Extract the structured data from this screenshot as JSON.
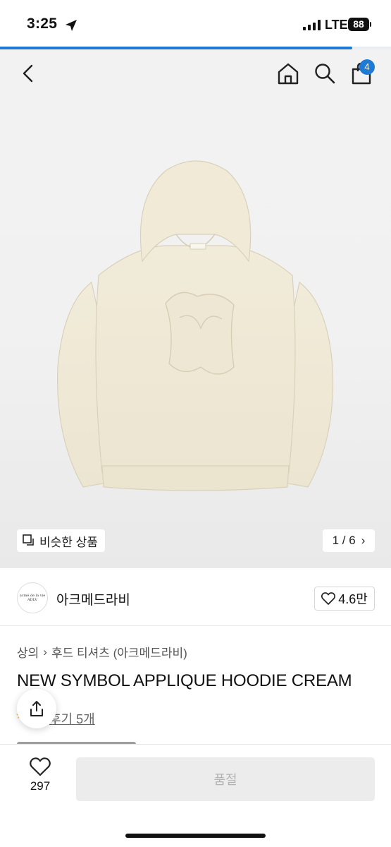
{
  "status_bar": {
    "time": "3:25",
    "network": "LTE",
    "battery": "88"
  },
  "page_load_progress": 0.9,
  "header": {
    "cart_count": "4"
  },
  "gallery": {
    "similar_label": "비슷한 상품",
    "page_indicator": "1 / 6",
    "chevron": "›"
  },
  "brand": {
    "logo_line1": "acmé de la vie",
    "logo_line2": "ADLV",
    "name": "아크메드라비",
    "likes": "4.6만"
  },
  "product": {
    "breadcrumb": [
      "상의",
      "후드 티셔츠 (아크메드라비)"
    ],
    "breadcrumb_separator": "›",
    "title": "NEW SYMBOL APPLIQUE HOODIE CREAM",
    "review_link": "후기 5개"
  },
  "bottom_bar": {
    "wish_count": "297",
    "buy_label": "품절"
  },
  "colors": {
    "accent": "#1f7ad6",
    "hoodie": "#f1ebd9",
    "sold_out_bg": "#ececec"
  },
  "icons": [
    "location-arrow-icon",
    "back-arrow-icon",
    "home-icon",
    "search-icon",
    "shopping-bag-icon",
    "overlap-squares-icon",
    "heart-icon",
    "share-icon",
    "chevron-right-icon"
  ]
}
